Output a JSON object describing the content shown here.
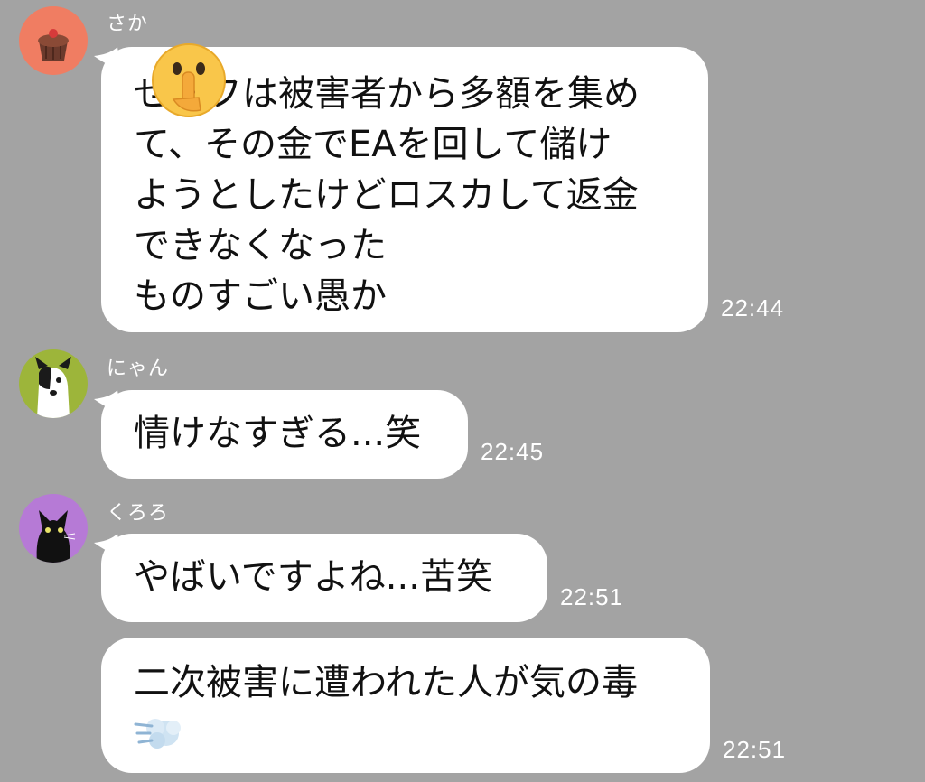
{
  "messages": [
    {
      "sender": "さか",
      "lines": [
        "せ　フは被害者から多額を集め",
        "て、その金でEAを回して儲け",
        "ようとしたけどロスカして返金",
        "できなくなった",
        "ものすごい愚か"
      ],
      "time": "22:44",
      "emoji_overlay": "shushing-face-emoji"
    },
    {
      "sender": "にゃん",
      "lines": [
        "情けなすぎる...笑"
      ],
      "time": "22:45"
    },
    {
      "sender": "くろろ",
      "lines": [
        "やばいですよね...苦笑"
      ],
      "time": "22:51"
    },
    {
      "sender": "くろろ",
      "lines": [
        "二次被害に遭われた人が気の毒"
      ],
      "time": "22:51",
      "trailing_emoji": "dash-symbol-emoji"
    }
  ],
  "colors": {
    "background": "#a3a3a3",
    "bubble": "#ffffff",
    "text": "#111111",
    "meta_text": "#ffffff"
  }
}
